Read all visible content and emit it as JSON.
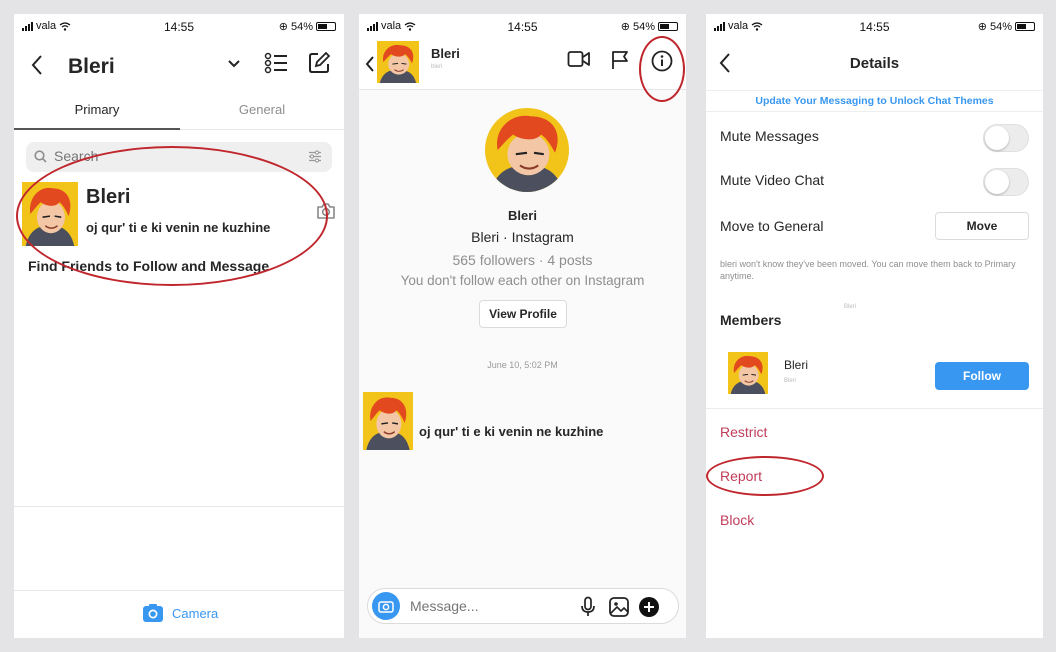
{
  "status_bar": {
    "carrier": "vala",
    "time": "14:55",
    "battery": "54%"
  },
  "inbox": {
    "title": "Bleri",
    "tabs": [
      "Primary",
      "General"
    ],
    "search_placeholder": "Search",
    "conversation": {
      "name": "Bleri",
      "preview": "oj qur' ti e ki venin ne kuzhine"
    },
    "find_friends": "Find Friends to Follow and Message",
    "camera_label": "Camera"
  },
  "chat": {
    "header_name": "Bleri",
    "header_sub": "bleri",
    "profile_name": "Bleri",
    "profile_sub": "Bleri · Instagram",
    "stats": "565 followers · 4 posts",
    "follow_status": "You don't follow each other on Instagram",
    "view_profile": "View Profile",
    "date": "June 10, 5:02 PM",
    "message": "oj qur' ti e ki venin ne kuzhine",
    "input_placeholder": "Message..."
  },
  "details": {
    "title": "Details",
    "banner": "Update Your Messaging to Unlock Chat Themes",
    "mute_messages": "Mute Messages",
    "mute_video": "Mute Video Chat",
    "move_general": "Move to General",
    "move_button": "Move",
    "note": "bleri  won't know they've been moved. You can move them back to Primary anytime.",
    "tiny_label": "Bleri",
    "members_heading": "Members",
    "member_name": "Bleri",
    "member_sub": "Bleri",
    "follow_button": "Follow",
    "actions": [
      "Restrict",
      "Report",
      "Block"
    ]
  },
  "colors": {
    "accent": "#3897f0",
    "destructive": "#c13d59",
    "annotation": "#c0272d"
  }
}
